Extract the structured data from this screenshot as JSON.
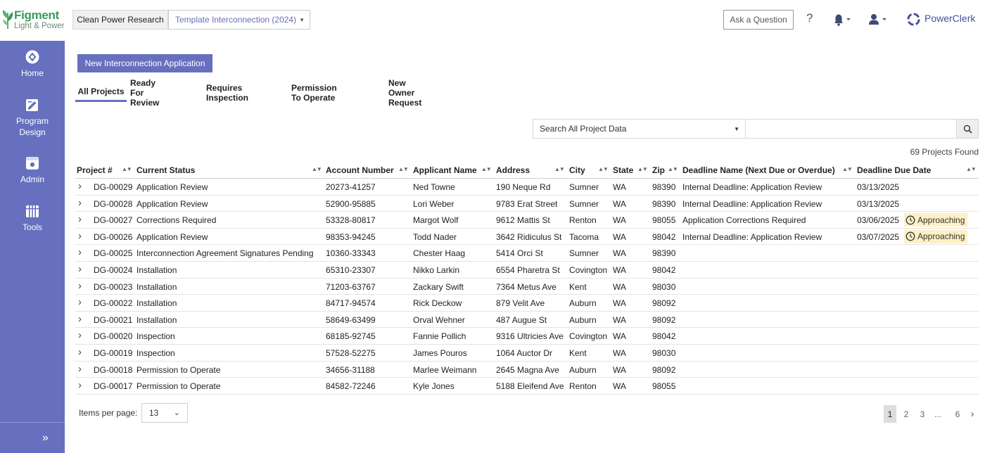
{
  "header": {
    "logo_name": "Figment",
    "logo_sub": "Light & Power",
    "tenant_label": "Clean Power Research",
    "template_label": "Template Interconnection (2024)",
    "ask_label": "Ask a Question",
    "help_label": "?",
    "brand_label": "PowerClerk"
  },
  "sidebar": {
    "items": [
      {
        "label_l1": "Home",
        "label_l2": "",
        "icon": "home-icon"
      },
      {
        "label_l1": "Program",
        "label_l2": "Design",
        "icon": "program-design-icon"
      },
      {
        "label_l1": "Admin",
        "label_l2": "",
        "icon": "admin-icon"
      },
      {
        "label_l1": "Tools",
        "label_l2": "",
        "icon": "tools-icon"
      }
    ],
    "expand_glyph": "»"
  },
  "main": {
    "new_app_label": "New Interconnection Application",
    "tabs": [
      "All Projects",
      "Ready For Review",
      "Requires Inspection",
      "Permission To Operate",
      "New Owner Request"
    ],
    "search": {
      "scope": "Search All Project Data",
      "value": ""
    },
    "count_label": "69 Projects Found"
  },
  "table": {
    "columns": [
      "Project #",
      "Current Status",
      "Account Number",
      "Applicant Name",
      "Address",
      "City",
      "State",
      "Zip",
      "Deadline Name (Next Due or Overdue)",
      "Deadline Due Date"
    ],
    "rows": [
      {
        "id": "DG-00029",
        "status": "Application Review",
        "account": "20273-41257",
        "applicant": "Ned Towne",
        "address": "190 Neque Rd",
        "city": "Sumner",
        "state": "WA",
        "zip": "98390",
        "deadline": "Internal Deadline: Application Review",
        "due": "03/13/2025",
        "badge": ""
      },
      {
        "id": "DG-00028",
        "status": "Application Review",
        "account": "52900-95885",
        "applicant": "Lori Weber",
        "address": "9783 Erat Street",
        "city": "Sumner",
        "state": "WA",
        "zip": "98390",
        "deadline": "Internal Deadline: Application Review",
        "due": "03/13/2025",
        "badge": ""
      },
      {
        "id": "DG-00027",
        "status": "Corrections Required",
        "account": "53328-80817",
        "applicant": "Margot Wolf",
        "address": "9612 Mattis St",
        "city": "Renton",
        "state": "WA",
        "zip": "98055",
        "deadline": "Application Corrections Required",
        "due": "03/06/2025",
        "badge": "Approaching"
      },
      {
        "id": "DG-00026",
        "status": "Application Review",
        "account": "98353-94245",
        "applicant": "Todd Nader",
        "address": "3642 Ridiculus St",
        "city": "Tacoma",
        "state": "WA",
        "zip": "98042",
        "deadline": "Internal Deadline: Application Review",
        "due": "03/07/2025",
        "badge": "Approaching"
      },
      {
        "id": "DG-00025",
        "status": "Interconnection Agreement Signatures Pending",
        "account": "10360-33343",
        "applicant": "Chester Haag",
        "address": "5414 Orci St",
        "city": "Sumner",
        "state": "WA",
        "zip": "98390",
        "deadline": "",
        "due": "",
        "badge": ""
      },
      {
        "id": "DG-00024",
        "status": "Installation",
        "account": "65310-23307",
        "applicant": "Nikko Larkin",
        "address": "6554 Pharetra St",
        "city": "Covington",
        "state": "WA",
        "zip": "98042",
        "deadline": "",
        "due": "",
        "badge": ""
      },
      {
        "id": "DG-00023",
        "status": "Installation",
        "account": "71203-63767",
        "applicant": "Zackary Swift",
        "address": "7364 Metus Ave",
        "city": "Kent",
        "state": "WA",
        "zip": "98030",
        "deadline": "",
        "due": "",
        "badge": ""
      },
      {
        "id": "DG-00022",
        "status": "Installation",
        "account": "84717-94574",
        "applicant": "Rick Deckow",
        "address": "879 Velit Ave",
        "city": "Auburn",
        "state": "WA",
        "zip": "98092",
        "deadline": "",
        "due": "",
        "badge": ""
      },
      {
        "id": "DG-00021",
        "status": "Installation",
        "account": "58649-63499",
        "applicant": "Orval Wehner",
        "address": "487 Augue St",
        "city": "Auburn",
        "state": "WA",
        "zip": "98092",
        "deadline": "",
        "due": "",
        "badge": ""
      },
      {
        "id": "DG-00020",
        "status": "Inspection",
        "account": "68185-92745",
        "applicant": "Fannie Pollich",
        "address": "9316 Ultricies Ave",
        "city": "Covington",
        "state": "WA",
        "zip": "98042",
        "deadline": "",
        "due": "",
        "badge": ""
      },
      {
        "id": "DG-00019",
        "status": "Inspection",
        "account": "57528-52275",
        "applicant": "James Pouros",
        "address": "1064 Auctor Dr",
        "city": "Kent",
        "state": "WA",
        "zip": "98030",
        "deadline": "",
        "due": "",
        "badge": ""
      },
      {
        "id": "DG-00018",
        "status": "Permission to Operate",
        "account": "34656-31188",
        "applicant": "Marlee Weimann",
        "address": "2645 Magna Ave",
        "city": "Auburn",
        "state": "WA",
        "zip": "98092",
        "deadline": "",
        "due": "",
        "badge": ""
      },
      {
        "id": "DG-00017",
        "status": "Permission to Operate",
        "account": "84582-72246",
        "applicant": "Kyle Jones",
        "address": "5188 Eleifend Ave",
        "city": "Renton",
        "state": "WA",
        "zip": "98055",
        "deadline": "",
        "due": "",
        "badge": ""
      }
    ]
  },
  "footer": {
    "items_per_page_label": "Items per page:",
    "items_per_page_value": "13",
    "pages": [
      "1",
      "2",
      "3",
      "...",
      "6"
    ],
    "active_page": "1",
    "next_glyph": "›"
  },
  "colors": {
    "sidebar": "#6770be",
    "accent": "#6770be",
    "badge_bg": "#fdf1c4",
    "logo_green": "#3a9a5b"
  }
}
